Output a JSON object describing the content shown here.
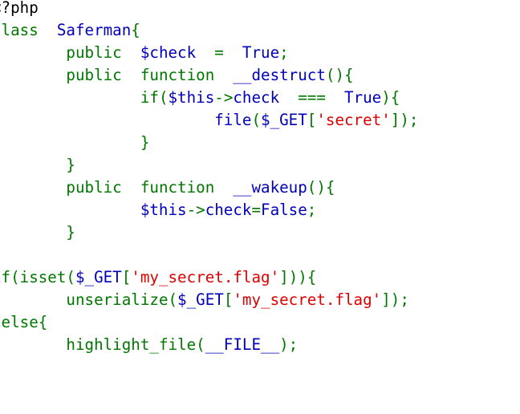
{
  "colors": {
    "keyword": "#007700",
    "default": "#0000BB",
    "string": "#DD0000",
    "html": "#000000"
  },
  "code": {
    "lines": [
      [
        [
          "html",
          "<?php"
        ]
      ],
      [
        [
          "keyword",
          "class"
        ],
        [
          "default",
          "  Saferman"
        ],
        [
          "keyword",
          "{"
        ]
      ],
      [
        [
          "default",
          "        "
        ],
        [
          "keyword",
          "public"
        ],
        [
          "default",
          "  $check  "
        ],
        [
          "keyword",
          "=  "
        ],
        [
          "default",
          "True"
        ],
        [
          "keyword",
          ";"
        ]
      ],
      [
        [
          "default",
          "        "
        ],
        [
          "keyword",
          "public  function  "
        ],
        [
          "default",
          "__destruct"
        ],
        [
          "keyword",
          "(){"
        ]
      ],
      [
        [
          "default",
          "                "
        ],
        [
          "keyword",
          "if("
        ],
        [
          "default",
          "$this"
        ],
        [
          "keyword",
          "->"
        ],
        [
          "default",
          "check  "
        ],
        [
          "keyword",
          "===  "
        ],
        [
          "default",
          "True"
        ],
        [
          "keyword",
          "){"
        ]
      ],
      [
        [
          "default",
          "                        file"
        ],
        [
          "keyword",
          "("
        ],
        [
          "default",
          "$_GET"
        ],
        [
          "keyword",
          "["
        ],
        [
          "string",
          "'secret'"
        ],
        [
          "keyword",
          "]);"
        ]
      ],
      [
        [
          "keyword",
          "                }"
        ]
      ],
      [
        [
          "keyword",
          "        }"
        ]
      ],
      [
        [
          "default",
          "        "
        ],
        [
          "keyword",
          "public  function  "
        ],
        [
          "default",
          "__wakeup"
        ],
        [
          "keyword",
          "(){"
        ]
      ],
      [
        [
          "default",
          "                $this"
        ],
        [
          "keyword",
          "->"
        ],
        [
          "default",
          "check"
        ],
        [
          "keyword",
          "="
        ],
        [
          "default",
          "False"
        ],
        [
          "keyword",
          ";"
        ]
      ],
      [
        [
          "keyword",
          "        }"
        ]
      ],
      [
        [
          "keyword",
          "}"
        ]
      ],
      [
        [
          "keyword",
          "if(isset("
        ],
        [
          "default",
          "$_GET"
        ],
        [
          "keyword",
          "["
        ],
        [
          "string",
          "'my_secret.flag'"
        ],
        [
          "keyword",
          "])){"
        ]
      ],
      [
        [
          "default",
          "        "
        ],
        [
          "keyword",
          "unserialize("
        ],
        [
          "default",
          "$_GET"
        ],
        [
          "keyword",
          "["
        ],
        [
          "string",
          "'my_secret.flag'"
        ],
        [
          "keyword",
          "]);"
        ]
      ],
      [
        [
          "keyword",
          "}else{"
        ]
      ],
      [
        [
          "default",
          "        "
        ],
        [
          "keyword",
          "highlight_file("
        ],
        [
          "default",
          "__FILE__"
        ],
        [
          "keyword",
          ");"
        ]
      ],
      [
        [
          "keyword",
          "}"
        ]
      ]
    ]
  }
}
